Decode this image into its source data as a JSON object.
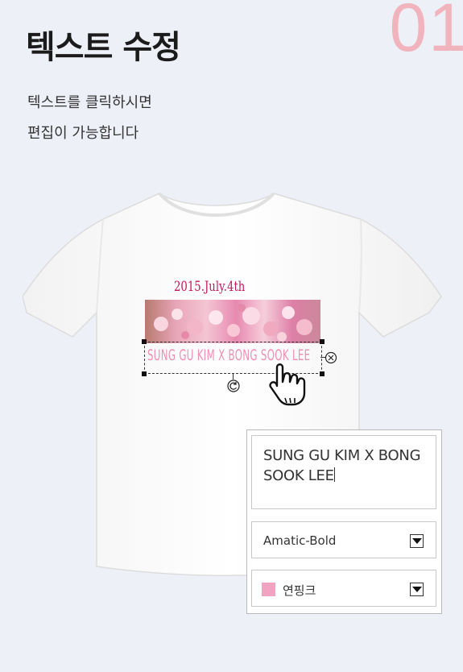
{
  "step": {
    "number": "01"
  },
  "header": {
    "title": "텍스트 수정"
  },
  "description": {
    "line1": "텍스트를 클릭하시면",
    "line2": "편집이 가능합니다"
  },
  "design": {
    "date_text": "2015.July.4th",
    "name_text": "SUNG GU KIM X BONG SOOK LEE"
  },
  "panel": {
    "text_value_line1": "SUNG GU KIM X BON",
    "text_value_line2": "G SOOK LEE",
    "font_selected": "Amatic-Bold",
    "color_selected": "연핑크",
    "color_hex": "#f1a4c2"
  },
  "colors": {
    "step_number": "#f1b4bd",
    "background": "#eef0f8",
    "design_text": "#ee8fb4",
    "date_text": "#c2185b"
  }
}
